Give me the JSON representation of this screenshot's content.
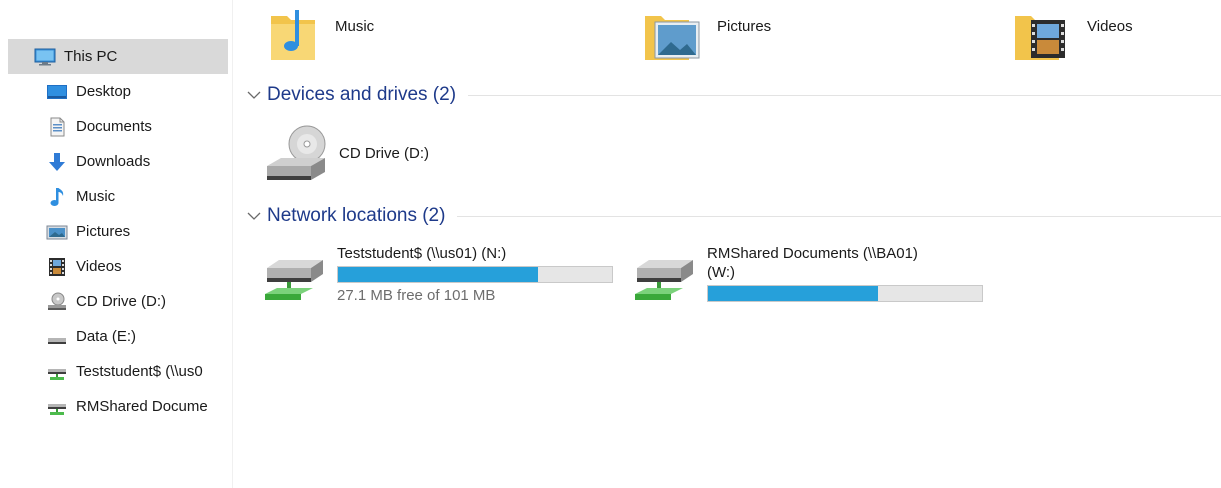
{
  "sidebar": {
    "items": [
      {
        "label": "This PC",
        "icon": "monitor-icon",
        "selected": true
      },
      {
        "label": "Desktop",
        "icon": "desktop-icon"
      },
      {
        "label": "Documents",
        "icon": "document-icon"
      },
      {
        "label": "Downloads",
        "icon": "download-arrow-icon"
      },
      {
        "label": "Music",
        "icon": "music-note-icon"
      },
      {
        "label": "Pictures",
        "icon": "pictures-icon"
      },
      {
        "label": "Videos",
        "icon": "film-strip-icon"
      },
      {
        "label": "CD Drive (D:)",
        "icon": "cd-drive-icon"
      },
      {
        "label": "Data (E:)",
        "icon": "drive-icon"
      },
      {
        "label": "Teststudent$ (\\\\us0",
        "icon": "network-drive-icon"
      },
      {
        "label": "RMShared Docume",
        "icon": "network-drive-icon"
      }
    ]
  },
  "folders": [
    {
      "name": "Music",
      "icon": "music-folder-icon"
    },
    {
      "name": "Pictures",
      "icon": "pictures-folder-icon"
    },
    {
      "name": "Videos",
      "icon": "videos-folder-icon"
    }
  ],
  "sections": {
    "devices": {
      "title": "Devices and drives (2)"
    },
    "network": {
      "title": "Network locations (2)"
    }
  },
  "devices": [
    {
      "name": "CD Drive (D:)",
      "icon": "cd-drive-icon"
    }
  ],
  "network_locations": [
    {
      "name": "Teststudent$ (\\\\us01) (N:)",
      "free_text": "27.1 MB free of 101 MB",
      "used_fraction": 0.73,
      "icon": "network-drive-icon"
    },
    {
      "name_line1": "RMShared Documents (\\\\BA01)",
      "name_line2": "(W:)",
      "used_fraction": 0.62,
      "icon": "network-drive-icon"
    }
  ],
  "colors": {
    "selected_bg": "#d9d9d9",
    "section_header": "#1e3a8a",
    "progress_fill": "#26a0da",
    "progress_track": "#e6e6e6"
  }
}
